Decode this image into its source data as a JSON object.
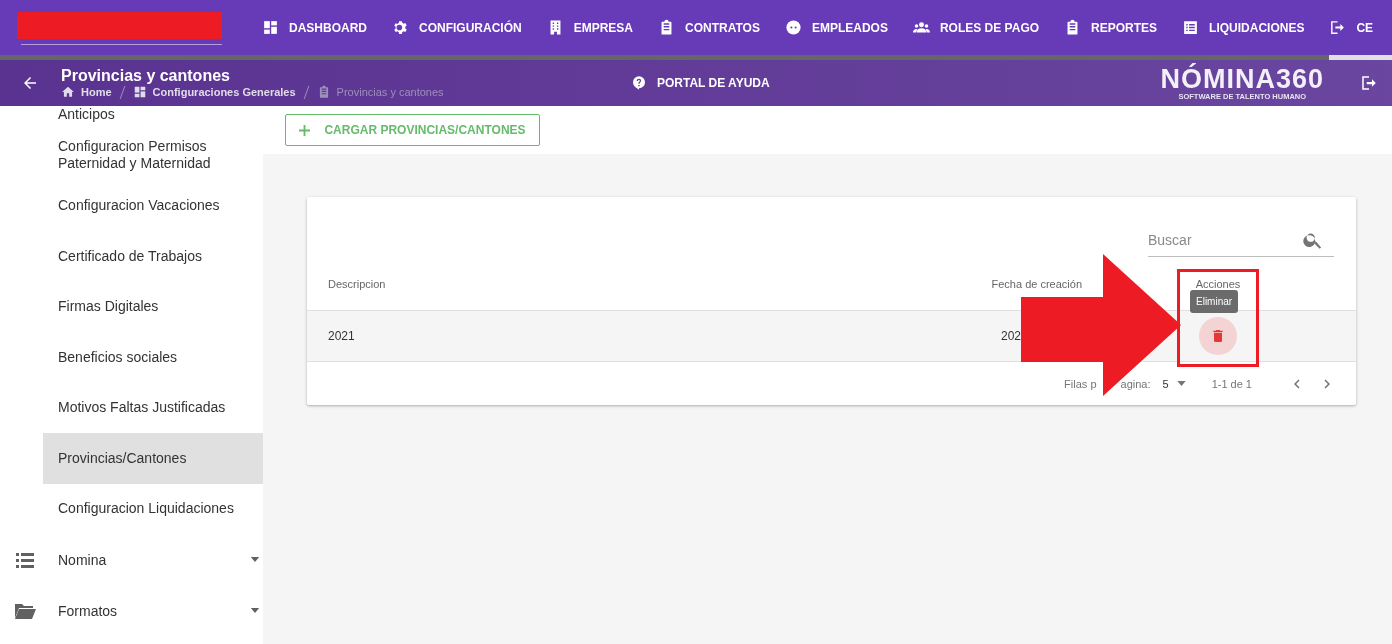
{
  "top_nav": {
    "items": [
      {
        "label": "DASHBOARD",
        "selected": false
      },
      {
        "label": "CONFIGURACIÓN",
        "selected": false
      },
      {
        "label": "EMPRESA",
        "selected": false
      },
      {
        "label": "CONTRATOS",
        "selected": false
      },
      {
        "label": "EMPLEADOS",
        "selected": false
      },
      {
        "label": "ROLES DE PAGO",
        "selected": false
      },
      {
        "label": "REPORTES",
        "selected": false
      },
      {
        "label": "LIQUIDACIONES",
        "selected": false
      },
      {
        "label": "CE",
        "selected": true
      }
    ]
  },
  "page_header": {
    "title": "Provincias y cantones",
    "breadcrumb": [
      {
        "label": "Home",
        "current": false
      },
      {
        "label": "Configuraciones Generales",
        "current": false
      },
      {
        "label": "Provincias y cantones",
        "current": true
      }
    ],
    "help_link": "PORTAL DE AYUDA",
    "logo": {
      "name": "NÓMINA360",
      "tagline": "SOFTWARE DE TALENTO HUMANO"
    }
  },
  "sidebar": {
    "items": [
      {
        "label": "Anticipos",
        "selected": false
      },
      {
        "label": "Configuracion Permisos Paternidad y Maternidad",
        "selected": false
      },
      {
        "label": "Configuracion Vacaciones",
        "selected": false
      },
      {
        "label": "Certificado de Trabajos",
        "selected": false
      },
      {
        "label": "Firmas Digitales",
        "selected": false
      },
      {
        "label": "Beneficios sociales",
        "selected": false
      },
      {
        "label": "Motivos Faltas Justificadas",
        "selected": false
      },
      {
        "label": "Provincias/Cantones",
        "selected": true
      },
      {
        "label": "Configuracion Liquidaciones",
        "selected": false
      }
    ],
    "groups": [
      {
        "label": "Nomina",
        "expanded": false
      },
      {
        "label": "Formatos",
        "expanded": false
      }
    ]
  },
  "load_button": "CARGAR PROVINCIAS/CANTONES",
  "search": {
    "placeholder": "Buscar"
  },
  "table": {
    "columns": [
      "Descripcion",
      "Fecha de creación",
      "Acciones"
    ],
    "rows": [
      {
        "descripcion": "2021",
        "fecha": "202"
      }
    ],
    "tooltip": "Eliminar",
    "pager": {
      "label_start": "Filas p",
      "label_end": "agina:",
      "rows_per_page": "5",
      "range": "1-1 de 1"
    }
  }
}
